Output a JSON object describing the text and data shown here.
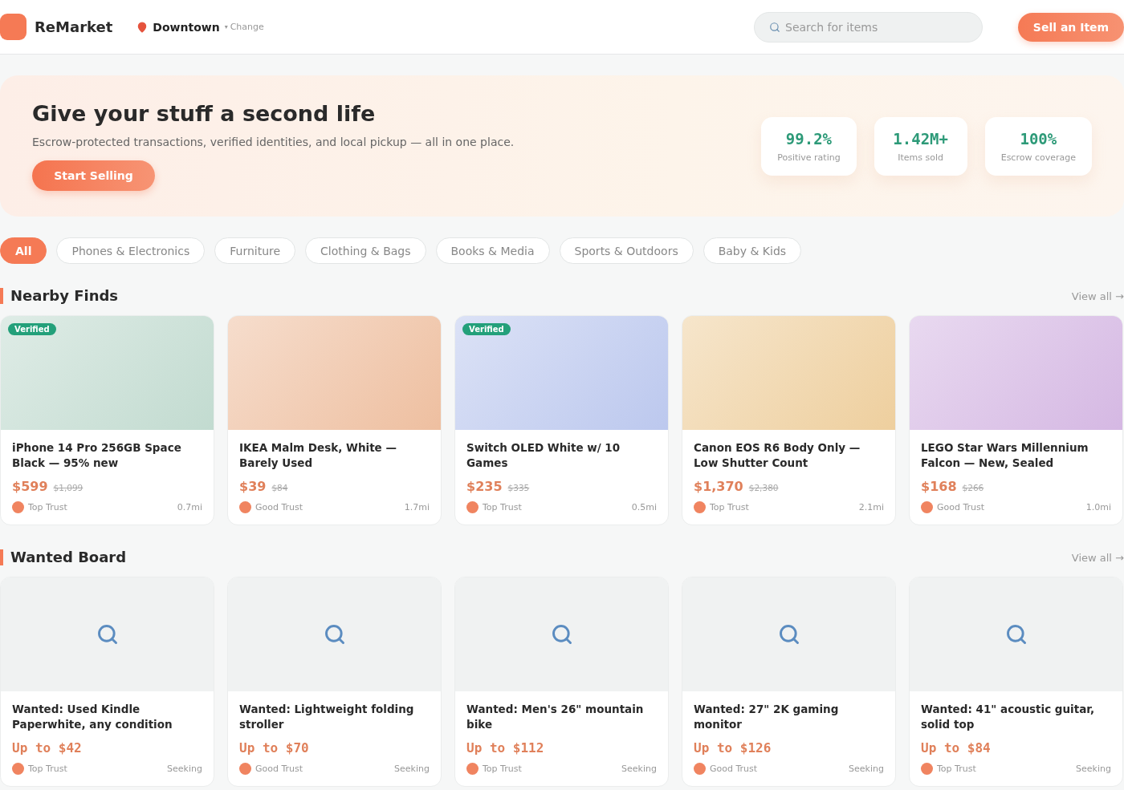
{
  "header": {
    "logo": "ReMarket",
    "location": "Downtown",
    "change_caret": "▾",
    "change": "Change",
    "search": {
      "placeholder": "Search for items"
    },
    "sell_button": "Sell an Item"
  },
  "hero": {
    "title": "Give your stuff a second life",
    "subtitle": "Escrow-protected transactions, verified identities, and local pickup — all in one place.",
    "button": "Start Selling",
    "stats": [
      {
        "value": "99.2%",
        "label": "Positive rating"
      },
      {
        "value": "1.42M+",
        "label": "Items sold"
      },
      {
        "value": "100%",
        "label": "Escrow coverage"
      }
    ]
  },
  "categories": [
    {
      "label": "All",
      "selected": true
    },
    {
      "label": "Phones & Electronics",
      "selected": false
    },
    {
      "label": "Furniture",
      "selected": false
    },
    {
      "label": "Clothing & Bags",
      "selected": false
    },
    {
      "label": "Books & Media",
      "selected": false
    },
    {
      "label": "Sports & Outdoors",
      "selected": false
    },
    {
      "label": "Baby & Kids",
      "selected": false
    }
  ],
  "nearby": {
    "title": "Nearby Finds",
    "view_all": "View all →",
    "items": [
      {
        "title": "iPhone 14 Pro 256GB Space Black — 95% new",
        "price": "$599",
        "old_price": "$1,099",
        "trust": "Top Trust",
        "distance": "0.7mi",
        "badge": "Verified",
        "color": "#c2dbd0"
      },
      {
        "title": "IKEA Malm Desk, White — Barely Used",
        "price": "$39",
        "old_price": "$84",
        "trust": "Good Trust",
        "distance": "1.7mi",
        "color": "#eebfa0"
      },
      {
        "title": "Switch OLED White w/ 10 Games",
        "price": "$235",
        "old_price": "$335",
        "trust": "Top Trust",
        "distance": "0.5mi",
        "badge": "Verified",
        "color": "#bcc8ee"
      },
      {
        "title": "Canon EOS R6 Body Only — Low Shutter Count",
        "price": "$1,370",
        "old_price": "$2,380",
        "trust": "Top Trust",
        "distance": "2.1mi",
        "color": "#eecf9e"
      },
      {
        "title": "LEGO Star Wars Millennium Falcon — New, Sealed",
        "price": "$168",
        "old_price": "$266",
        "trust": "Good Trust",
        "distance": "1.0mi",
        "color": "#d5b8e3"
      }
    ]
  },
  "wanted": {
    "title": "Wanted Board",
    "view_all": "View all →",
    "items": [
      {
        "title": "Wanted: Used Kindle Paperwhite, any condition",
        "budget": "Up to $42",
        "trust": "Top Trust",
        "status": "Seeking"
      },
      {
        "title": "Wanted: Lightweight folding stroller",
        "budget": "Up to $70",
        "trust": "Good Trust",
        "status": "Seeking"
      },
      {
        "title": "Wanted: Men's 26\" mountain bike",
        "budget": "Up to $112",
        "trust": "Top Trust",
        "status": "Seeking"
      },
      {
        "title": "Wanted: 27\" 2K gaming monitor",
        "budget": "Up to $126",
        "trust": "Good Trust",
        "status": "Seeking"
      },
      {
        "title": "Wanted: 41\" acoustic guitar, solid top",
        "budget": "Up to $84",
        "trust": "Top Trust",
        "status": "Seeking"
      }
    ]
  }
}
